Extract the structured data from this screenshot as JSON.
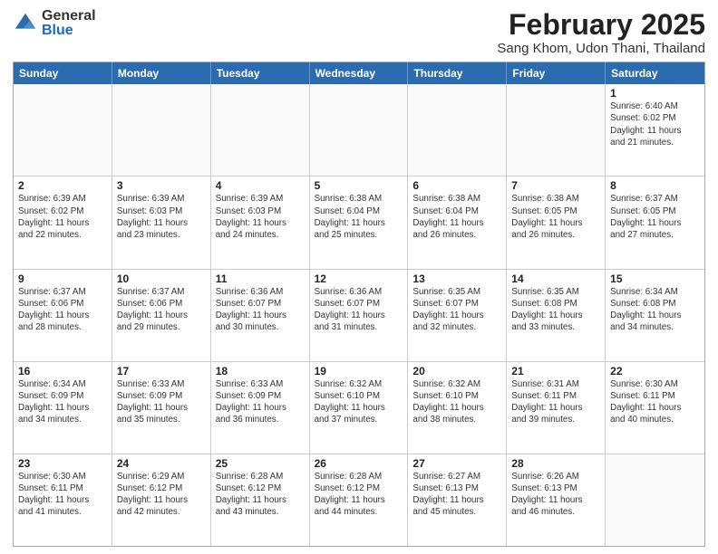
{
  "header": {
    "logo_general": "General",
    "logo_blue": "Blue",
    "month_title": "February 2025",
    "location": "Sang Khom, Udon Thani, Thailand"
  },
  "calendar": {
    "days_of_week": [
      "Sunday",
      "Monday",
      "Tuesday",
      "Wednesday",
      "Thursday",
      "Friday",
      "Saturday"
    ],
    "weeks": [
      [
        {
          "day": "",
          "info": ""
        },
        {
          "day": "",
          "info": ""
        },
        {
          "day": "",
          "info": ""
        },
        {
          "day": "",
          "info": ""
        },
        {
          "day": "",
          "info": ""
        },
        {
          "day": "",
          "info": ""
        },
        {
          "day": "1",
          "info": "Sunrise: 6:40 AM\nSunset: 6:02 PM\nDaylight: 11 hours\nand 21 minutes."
        }
      ],
      [
        {
          "day": "2",
          "info": "Sunrise: 6:39 AM\nSunset: 6:02 PM\nDaylight: 11 hours\nand 22 minutes."
        },
        {
          "day": "3",
          "info": "Sunrise: 6:39 AM\nSunset: 6:03 PM\nDaylight: 11 hours\nand 23 minutes."
        },
        {
          "day": "4",
          "info": "Sunrise: 6:39 AM\nSunset: 6:03 PM\nDaylight: 11 hours\nand 24 minutes."
        },
        {
          "day": "5",
          "info": "Sunrise: 6:38 AM\nSunset: 6:04 PM\nDaylight: 11 hours\nand 25 minutes."
        },
        {
          "day": "6",
          "info": "Sunrise: 6:38 AM\nSunset: 6:04 PM\nDaylight: 11 hours\nand 26 minutes."
        },
        {
          "day": "7",
          "info": "Sunrise: 6:38 AM\nSunset: 6:05 PM\nDaylight: 11 hours\nand 26 minutes."
        },
        {
          "day": "8",
          "info": "Sunrise: 6:37 AM\nSunset: 6:05 PM\nDaylight: 11 hours\nand 27 minutes."
        }
      ],
      [
        {
          "day": "9",
          "info": "Sunrise: 6:37 AM\nSunset: 6:06 PM\nDaylight: 11 hours\nand 28 minutes."
        },
        {
          "day": "10",
          "info": "Sunrise: 6:37 AM\nSunset: 6:06 PM\nDaylight: 11 hours\nand 29 minutes."
        },
        {
          "day": "11",
          "info": "Sunrise: 6:36 AM\nSunset: 6:07 PM\nDaylight: 11 hours\nand 30 minutes."
        },
        {
          "day": "12",
          "info": "Sunrise: 6:36 AM\nSunset: 6:07 PM\nDaylight: 11 hours\nand 31 minutes."
        },
        {
          "day": "13",
          "info": "Sunrise: 6:35 AM\nSunset: 6:07 PM\nDaylight: 11 hours\nand 32 minutes."
        },
        {
          "day": "14",
          "info": "Sunrise: 6:35 AM\nSunset: 6:08 PM\nDaylight: 11 hours\nand 33 minutes."
        },
        {
          "day": "15",
          "info": "Sunrise: 6:34 AM\nSunset: 6:08 PM\nDaylight: 11 hours\nand 34 minutes."
        }
      ],
      [
        {
          "day": "16",
          "info": "Sunrise: 6:34 AM\nSunset: 6:09 PM\nDaylight: 11 hours\nand 34 minutes."
        },
        {
          "day": "17",
          "info": "Sunrise: 6:33 AM\nSunset: 6:09 PM\nDaylight: 11 hours\nand 35 minutes."
        },
        {
          "day": "18",
          "info": "Sunrise: 6:33 AM\nSunset: 6:09 PM\nDaylight: 11 hours\nand 36 minutes."
        },
        {
          "day": "19",
          "info": "Sunrise: 6:32 AM\nSunset: 6:10 PM\nDaylight: 11 hours\nand 37 minutes."
        },
        {
          "day": "20",
          "info": "Sunrise: 6:32 AM\nSunset: 6:10 PM\nDaylight: 11 hours\nand 38 minutes."
        },
        {
          "day": "21",
          "info": "Sunrise: 6:31 AM\nSunset: 6:11 PM\nDaylight: 11 hours\nand 39 minutes."
        },
        {
          "day": "22",
          "info": "Sunrise: 6:30 AM\nSunset: 6:11 PM\nDaylight: 11 hours\nand 40 minutes."
        }
      ],
      [
        {
          "day": "23",
          "info": "Sunrise: 6:30 AM\nSunset: 6:11 PM\nDaylight: 11 hours\nand 41 minutes."
        },
        {
          "day": "24",
          "info": "Sunrise: 6:29 AM\nSunset: 6:12 PM\nDaylight: 11 hours\nand 42 minutes."
        },
        {
          "day": "25",
          "info": "Sunrise: 6:28 AM\nSunset: 6:12 PM\nDaylight: 11 hours\nand 43 minutes."
        },
        {
          "day": "26",
          "info": "Sunrise: 6:28 AM\nSunset: 6:12 PM\nDaylight: 11 hours\nand 44 minutes."
        },
        {
          "day": "27",
          "info": "Sunrise: 6:27 AM\nSunset: 6:13 PM\nDaylight: 11 hours\nand 45 minutes."
        },
        {
          "day": "28",
          "info": "Sunrise: 6:26 AM\nSunset: 6:13 PM\nDaylight: 11 hours\nand 46 minutes."
        },
        {
          "day": "",
          "info": ""
        }
      ]
    ]
  }
}
